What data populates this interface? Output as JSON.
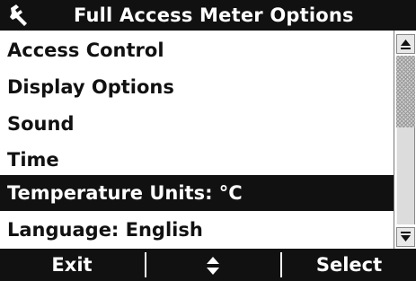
{
  "title_bar": {
    "icon": "wrench-icon",
    "title": "Full Access Meter Options"
  },
  "menu": {
    "items": [
      {
        "label": "Access Control"
      },
      {
        "label": "Display Options"
      },
      {
        "label": "Sound"
      },
      {
        "label": "Time"
      },
      {
        "label": "Temperature Units: °C",
        "selected": true
      },
      {
        "label": "Language: English"
      }
    ]
  },
  "scrollbar": {
    "up_icon": "scroll-up-arrow-icon",
    "down_icon": "scroll-down-arrow-icon"
  },
  "footer": {
    "exit_label": "Exit",
    "updown_icon": "up-down-arrows-icon",
    "select_label": "Select"
  },
  "colors": {
    "bar": "#111111",
    "text_on_bar": "#ffffff",
    "text": "#111111",
    "selected_bg": "#111111"
  }
}
